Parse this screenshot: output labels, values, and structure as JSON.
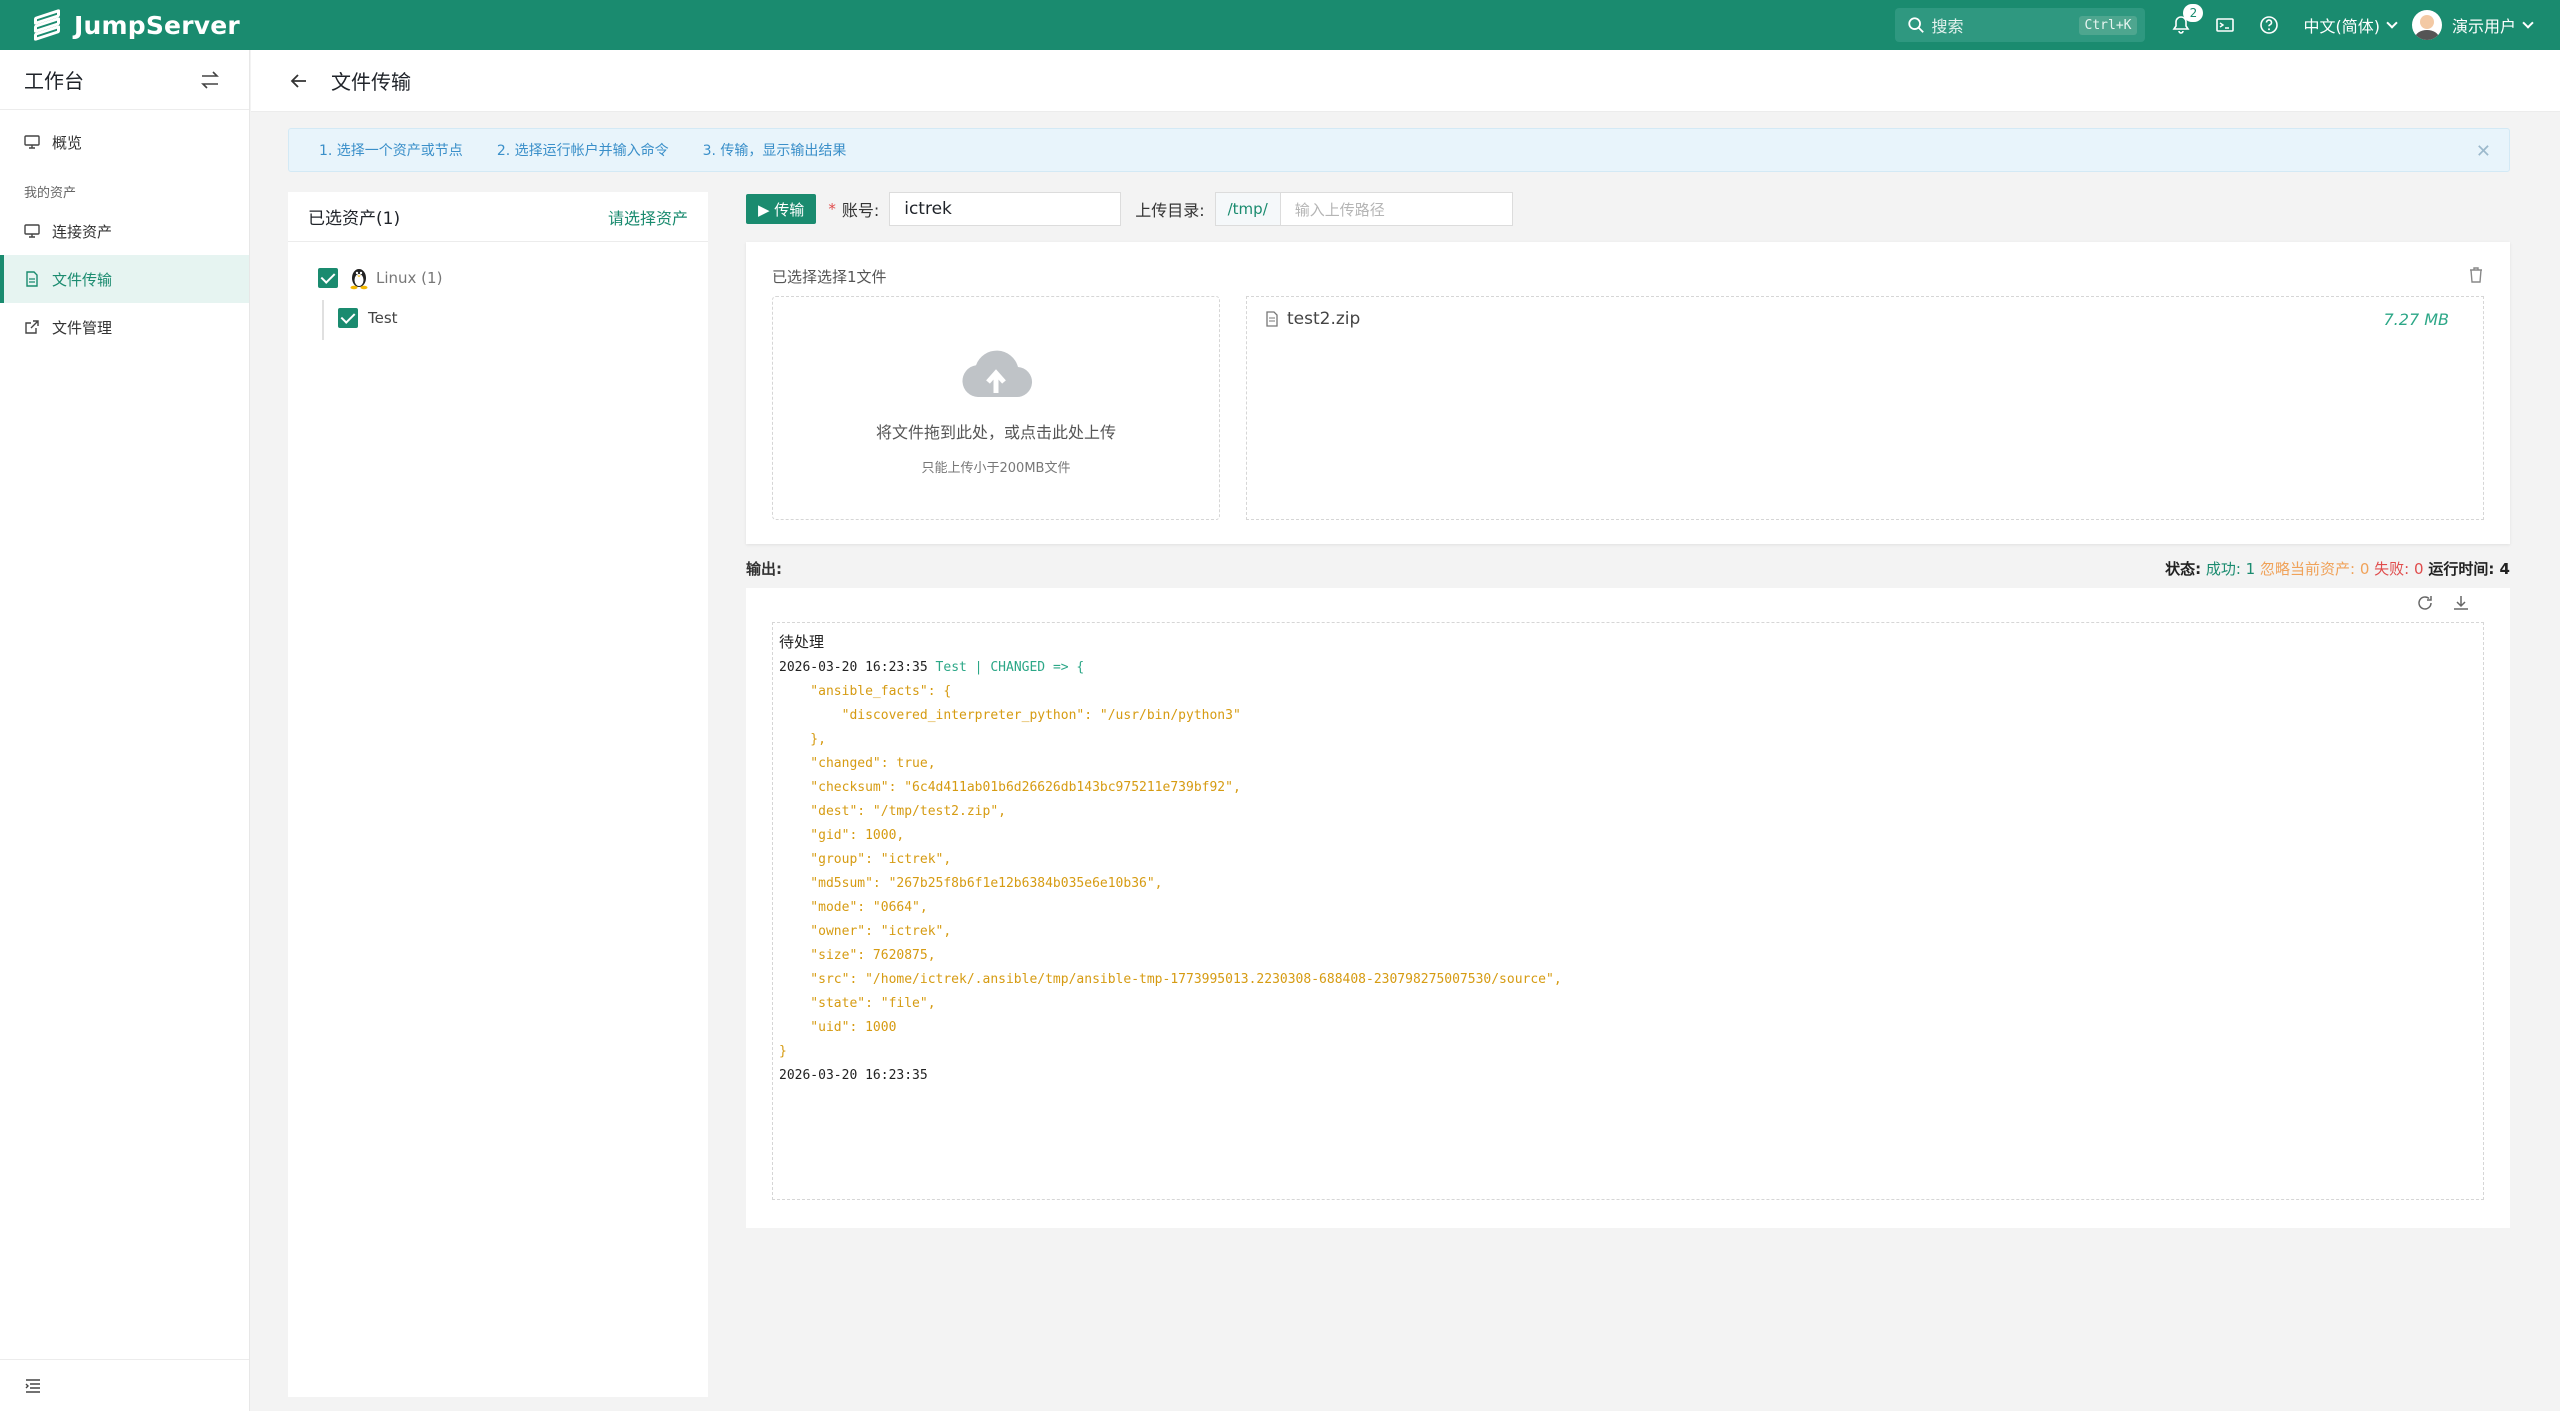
{
  "topbar": {
    "brand": "JumpServer",
    "search_label": "搜索",
    "search_shortcut": "Ctrl+K",
    "notification_count": "2",
    "language": "中文(简体)",
    "username": "演示用户",
    "bg_color": "#1a8b6f"
  },
  "sidebar": {
    "title": "工作台",
    "items": [
      {
        "label": "概览",
        "icon": "monitor-icon"
      }
    ],
    "group_label": "我的资产",
    "group_items": [
      {
        "label": "连接资产",
        "icon": "monitor-icon"
      },
      {
        "label": "文件传输",
        "icon": "file-icon",
        "active": true
      },
      {
        "label": "文件管理",
        "icon": "external-link-icon"
      }
    ]
  },
  "page": {
    "title": "文件传输"
  },
  "steps": [
    "1. 选择一个资产或节点",
    "2. 选择运行帐户并输入命令",
    "3. 传输，显示输出结果"
  ],
  "assets": {
    "title": "已选资产(1)",
    "pick_label": "请选择资产",
    "node_label": "Linux (1)",
    "host_label": "Test"
  },
  "toolbar": {
    "transfer_label": "▶ 传输",
    "required_mark": "*",
    "account_label": "账号:",
    "account_value": "ictrek",
    "upload_dir_label": "上传目录:",
    "upload_dir_prefix": "/tmp/",
    "upload_path_placeholder": "输入上传路径"
  },
  "upload": {
    "selected_label": "已选择选择1文件",
    "drop_text": "将文件拖到此处，或点击此处上传",
    "drop_tip": "只能上传小于200MB文件",
    "files": [
      {
        "name": "test2.zip",
        "size": "7.27 MB"
      }
    ]
  },
  "output": {
    "label": "输出:",
    "status_label": "状态:",
    "success_text": "成功: 1",
    "ignored_text": "忽略当前资产: 0",
    "fail_text": "失败: 0",
    "runtime_label": "运行时间: 4",
    "pending_label": "待处理",
    "header_ts": "2026-03-20 16:23:35",
    "header_host": "Test | CHANGED => {",
    "json_lines": [
      "    \"ansible_facts\": {",
      "        \"discovered_interpreter_python\": \"/usr/bin/python3\"",
      "    },",
      "    \"changed\": true,",
      "    \"checksum\": \"6c4d411ab01b6d26626db143bc975211e739bf92\",",
      "    \"dest\": \"/tmp/test2.zip\",",
      "    \"gid\": 1000,",
      "    \"group\": \"ictrek\",",
      "    \"md5sum\": \"267b25f8b6f1e12b6384b035e6e10b36\",",
      "    \"mode\": \"0664\",",
      "    \"owner\": \"ictrek\",",
      "    \"size\": 7620875,",
      "    \"src\": \"/home/ictrek/.ansible/tmp/ansible-tmp-1773995013.2230308-688408-230798275007530/source\",",
      "    \"state\": \"file\",",
      "    \"uid\": 1000",
      "}"
    ],
    "footer_ts": "2026-03-20 16:23:35"
  }
}
